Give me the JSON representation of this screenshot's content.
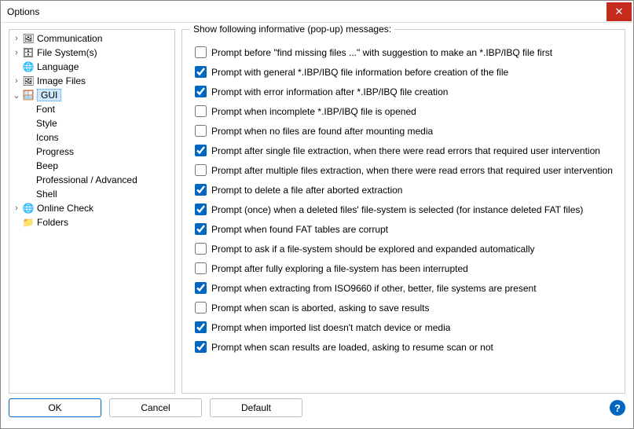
{
  "window": {
    "title": "Options"
  },
  "tree": {
    "items": [
      {
        "label": "Communication",
        "expandable": true,
        "icon": "comm-icon"
      },
      {
        "label": "File System(s)",
        "expandable": true,
        "icon": "filesystem-icon"
      },
      {
        "label": "Language",
        "expandable": false,
        "icon": "language-icon"
      },
      {
        "label": "Image Files",
        "expandable": true,
        "icon": "image-files-icon"
      },
      {
        "label": "GUI",
        "expandable": true,
        "expanded": true,
        "selected": true,
        "icon": "gui-icon",
        "children": [
          {
            "label": "Font"
          },
          {
            "label": "Style"
          },
          {
            "label": "Icons"
          },
          {
            "label": "Progress"
          },
          {
            "label": "Beep"
          },
          {
            "label": "Professional / Advanced"
          },
          {
            "label": "Shell"
          }
        ]
      },
      {
        "label": "Online Check",
        "expandable": true,
        "icon": "online-check-icon"
      },
      {
        "label": "Folders",
        "expandable": false,
        "icon": "folders-icon"
      }
    ]
  },
  "group": {
    "title": "Show following informative (pop-up) messages:",
    "options": [
      {
        "checked": false,
        "label": "Prompt before \"find missing files ...\" with suggestion to make an *.IBP/IBQ file first"
      },
      {
        "checked": true,
        "label": "Prompt with general *.IBP/IBQ file information before creation of the file"
      },
      {
        "checked": true,
        "label": "Prompt with error information after *.IBP/IBQ file creation"
      },
      {
        "checked": false,
        "label": "Prompt when incomplete *.IBP/IBQ file is opened"
      },
      {
        "checked": false,
        "label": "Prompt when no files are found after mounting media"
      },
      {
        "checked": true,
        "label": "Prompt after single file extraction, when there were read errors that required user intervention"
      },
      {
        "checked": false,
        "label": "Prompt after multiple files extraction, when there were read errors that required user intervention"
      },
      {
        "checked": true,
        "label": "Prompt to delete a file after aborted extraction"
      },
      {
        "checked": true,
        "label": "Prompt (once) when a deleted files' file-system is selected (for instance deleted FAT files)"
      },
      {
        "checked": true,
        "label": "Prompt when found FAT tables are corrupt"
      },
      {
        "checked": false,
        "label": "Prompt to ask if a file-system should be explored and expanded automatically"
      },
      {
        "checked": false,
        "label": "Prompt after fully exploring a file-system has been interrupted"
      },
      {
        "checked": true,
        "label": "Prompt when extracting from ISO9660 if other, better, file systems are present"
      },
      {
        "checked": false,
        "label": "Prompt when scan is aborted, asking to save results"
      },
      {
        "checked": true,
        "label": "Prompt when imported list doesn't match device or media"
      },
      {
        "checked": true,
        "label": "Prompt when scan results are loaded, asking to resume scan or not"
      }
    ]
  },
  "buttons": {
    "ok": "OK",
    "cancel": "Cancel",
    "default": "Default"
  }
}
